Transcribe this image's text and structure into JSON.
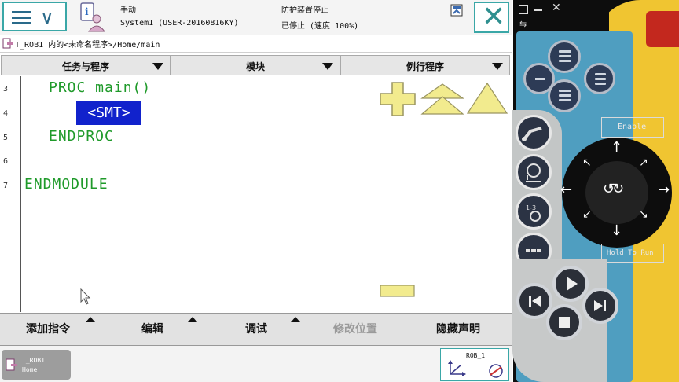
{
  "header": {
    "mode": "手动",
    "system_name": "System1 (USER-20160816KY)",
    "safety_status": "防护装置停止",
    "run_status": "已停止 (速度 100%)"
  },
  "path": "T_ROB1 内的<未命名程序>/Home/main",
  "tabs": [
    {
      "label": "任务与程序"
    },
    {
      "label": "模块"
    },
    {
      "label": "例行程序"
    }
  ],
  "editor": {
    "line_numbers": [
      "3",
      "4",
      "5",
      "6",
      "7"
    ],
    "lines": {
      "proc": "PROC main()",
      "smt": "<SMT>",
      "endproc": "ENDPROC",
      "endmodule": "ENDMODULE"
    }
  },
  "bottom_menu": {
    "add_instruction": "添加指令",
    "edit": "编辑",
    "debug": "调试",
    "modify_position": "修改位置",
    "hide_declarations": "隐藏声明"
  },
  "taskbar": {
    "task_name": "T_ROB1",
    "task_module": "Home",
    "jog_unit": "ROB_1"
  },
  "pendant": {
    "enable_label": "Enable",
    "hold_label": "Hold To Run"
  },
  "colors": {
    "code_green": "#1f9a2a",
    "selection_blue": "#1122cc",
    "accent_teal": "#3aa7a7",
    "yellow_button": "#f2eb8e"
  }
}
